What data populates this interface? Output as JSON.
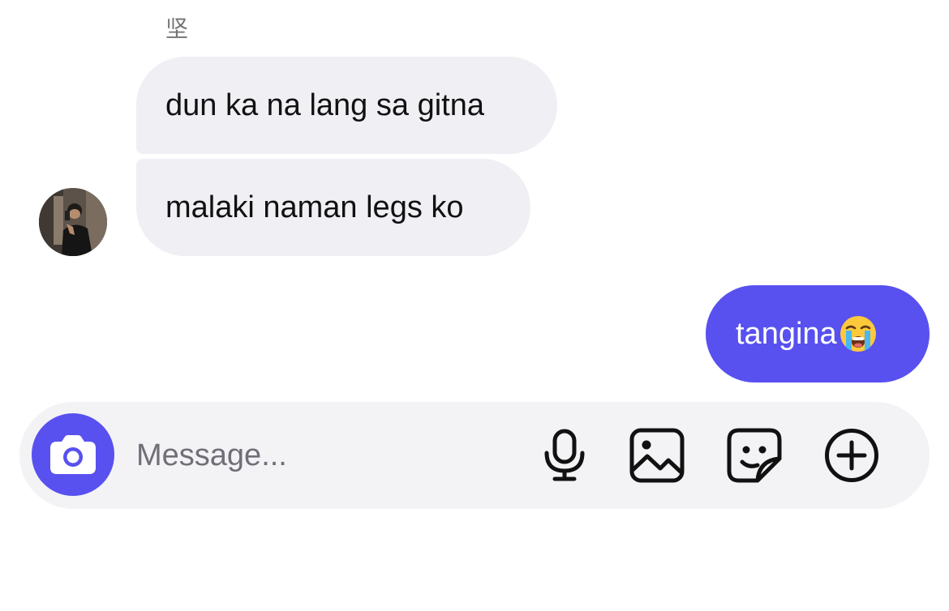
{
  "chat": {
    "sender_name": "坚",
    "messages": [
      {
        "direction": "incoming",
        "text": "dun ka na lang sa gitna"
      },
      {
        "direction": "incoming",
        "text": "malaki naman legs ko"
      },
      {
        "direction": "outgoing",
        "text": "tangina",
        "emoji": "loudly-crying-face"
      }
    ]
  },
  "composer": {
    "placeholder": "Message...",
    "value": "",
    "icons": [
      "camera-icon",
      "microphone-icon",
      "gallery-icon",
      "sticker-icon",
      "plus-circle-icon"
    ]
  },
  "colors": {
    "accent": "#5851ef",
    "incoming_bubble": "#efeff4",
    "composer_bg": "#f3f3f6"
  }
}
